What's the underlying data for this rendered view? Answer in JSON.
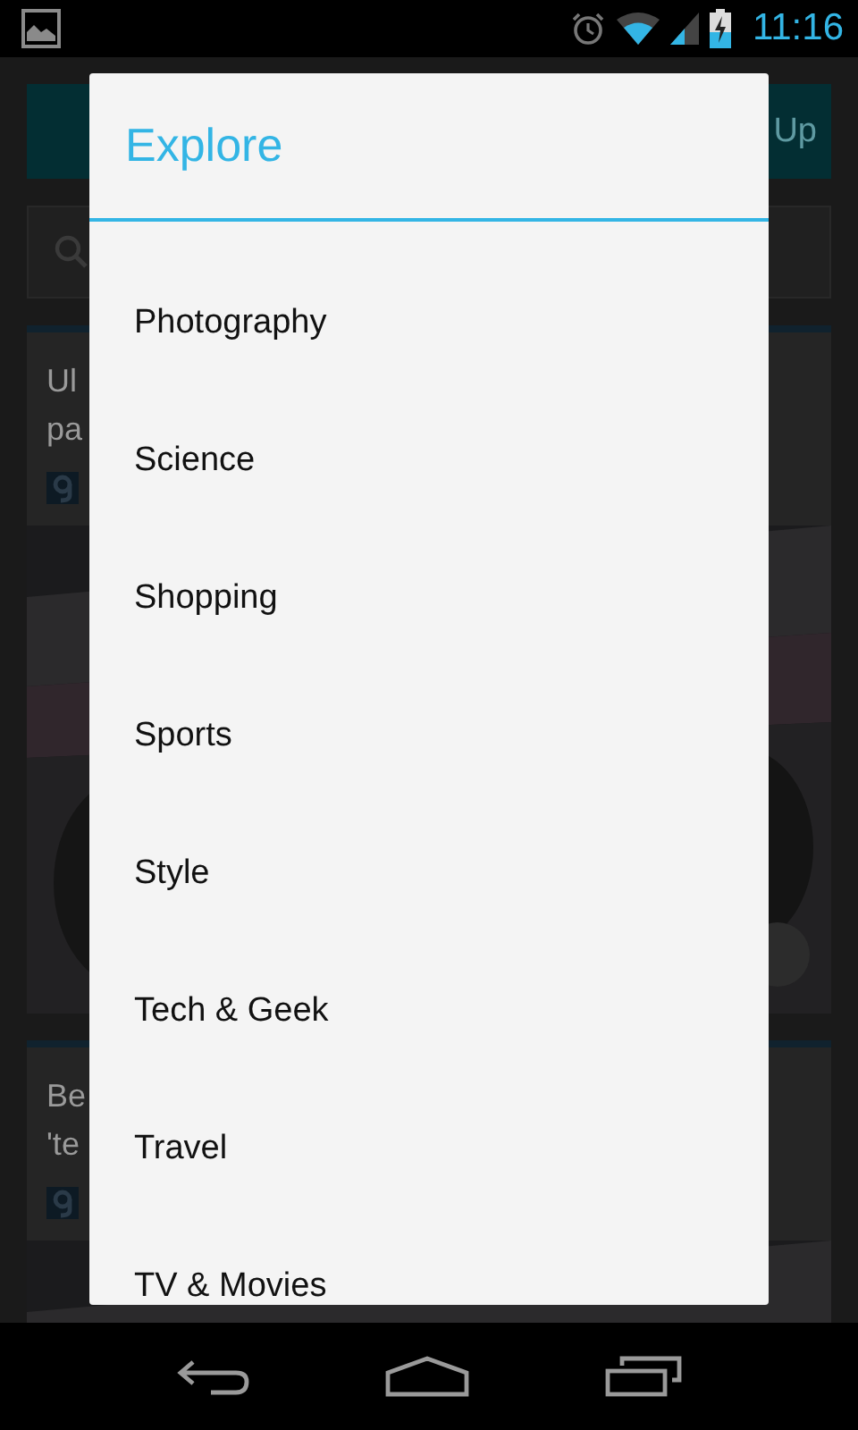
{
  "status_bar": {
    "time": "11:16"
  },
  "background": {
    "action_button": {
      "label": "Up"
    },
    "search": {
      "kind": "search"
    },
    "cards": [
      {
        "title_lines": [
          "Ul",
          "pa"
        ]
      },
      {
        "title_lines": [
          "Be",
          "'te"
        ]
      }
    ]
  },
  "dialog": {
    "title": "Explore",
    "items": [
      {
        "label": "Photography"
      },
      {
        "label": "Science"
      },
      {
        "label": "Shopping"
      },
      {
        "label": "Sports"
      },
      {
        "label": "Style"
      },
      {
        "label": "Tech & Geek"
      },
      {
        "label": "Travel"
      },
      {
        "label": "TV & Movies"
      }
    ]
  }
}
